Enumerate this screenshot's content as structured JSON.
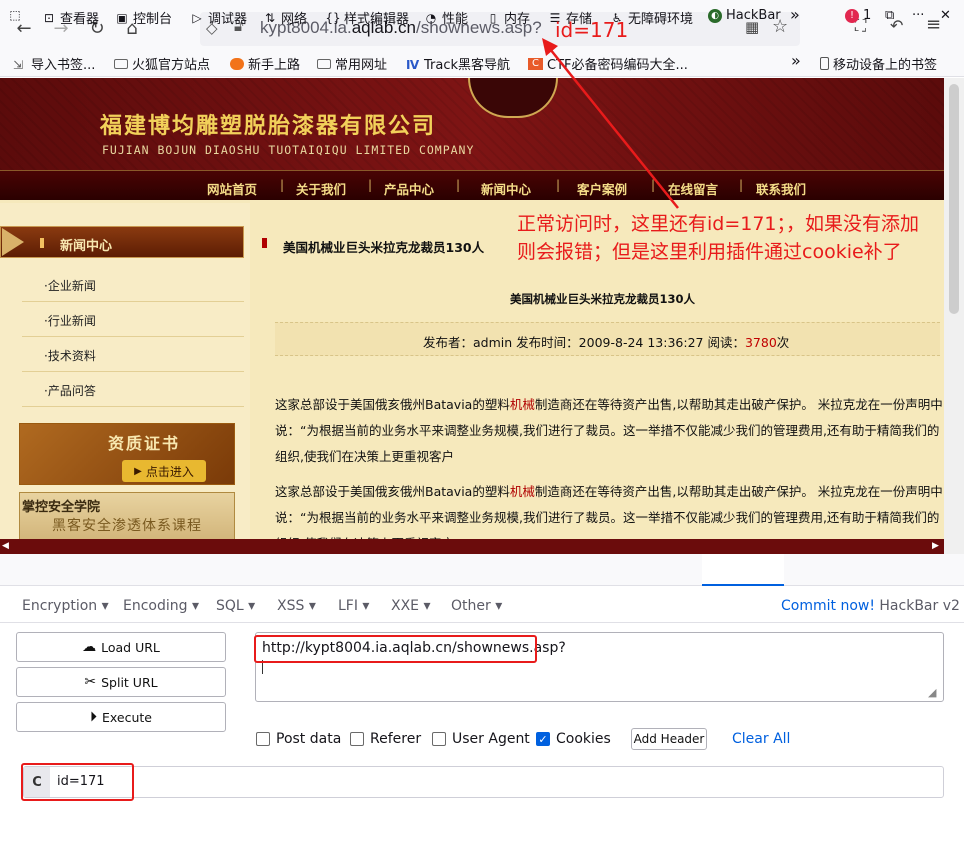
{
  "browser": {
    "url_prefix": "kypt8004.ia.",
    "url_domain": "aqlab.cn",
    "url_path": "/shownews.asp?",
    "bookmarks": [
      "导入书签...",
      "火狐官方站点",
      "新手上路",
      "常用网址",
      "Track黑客导航",
      "CTF必备密码编码大全...",
      "移动设备上的书签"
    ]
  },
  "site": {
    "company_cn": "福建博均雕塑脱胎漆器有限公司",
    "company_en": "FUJIAN BOJUN DIAOSHU  TUOTAIQIQU  LIMITED COMPANY",
    "nav": [
      "网站首页",
      "关于我们",
      "产品中心",
      "新闻中心",
      "客户案例",
      "在线留言",
      "联系我们"
    ],
    "sidebar_title": "新闻中心",
    "sidebar_items": [
      "·企业新闻",
      "·行业新闻",
      "·技术资料",
      "·产品问答"
    ],
    "cert_title": "资质证书",
    "cert_button": "点击进入",
    "edu_title": "掌控安全学院",
    "edu_sub": "黑客安全渗透体系课程",
    "article_heading": "美国机械业巨头米拉克龙裁员130人",
    "article_title": "美国机械业巨头米拉克龙裁员130人",
    "info": {
      "publisher_label": "发布者：",
      "publisher": "admin",
      "time_label": " 发布时间：",
      "time": "2009-8-24 13:36:27",
      "views_label": " 阅读：",
      "views": "3780",
      "views_unit": "次"
    },
    "para_before": "这家总部设于美国俄亥俄州Batavia的塑料",
    "para_kw": "机械",
    "para_after": "制造商还在等待资产出售,以帮助其走出破产保护。 米拉克龙在一份声明中说：“为根据当前的业务水平来调整业务规模,我们进行了裁员。这一举措不仅能减少我们的管理费用,还有助于精简我们的组织,使我们在决策上更重视客户"
  },
  "devtools": {
    "tabs": [
      "查看器",
      "控制台",
      "调试器",
      "网络",
      "样式编辑器",
      "性能",
      "内存",
      "存储",
      "无障碍环境",
      "HackBar"
    ],
    "error_count": "1"
  },
  "hackbar": {
    "menus": [
      "Encryption",
      "Encoding",
      "SQL",
      "XSS",
      "LFI",
      "XXE",
      "Other"
    ],
    "commit_link": "Commit now!",
    "version": " HackBar v2",
    "buttons": {
      "load": "Load URL",
      "split": "Split URL",
      "execute": "Execute"
    },
    "url_value": "http://kypt8004.ia.aqlab.cn/shownews.asp?",
    "options": {
      "post": "Post data",
      "referer": "Referer",
      "ua": "User Agent",
      "cookies": "Cookies"
    },
    "add_header": "Add Header",
    "clear_all": "Clear All",
    "cookie_label": "C",
    "cookie_value": "id=171"
  },
  "annotations": {
    "id_label": "id=171",
    "note": "正常访问时，这里还有id=171；，如果没有添加则会报错；但是这里利用插件通过cookie补了",
    "color": "#e81b1b"
  }
}
